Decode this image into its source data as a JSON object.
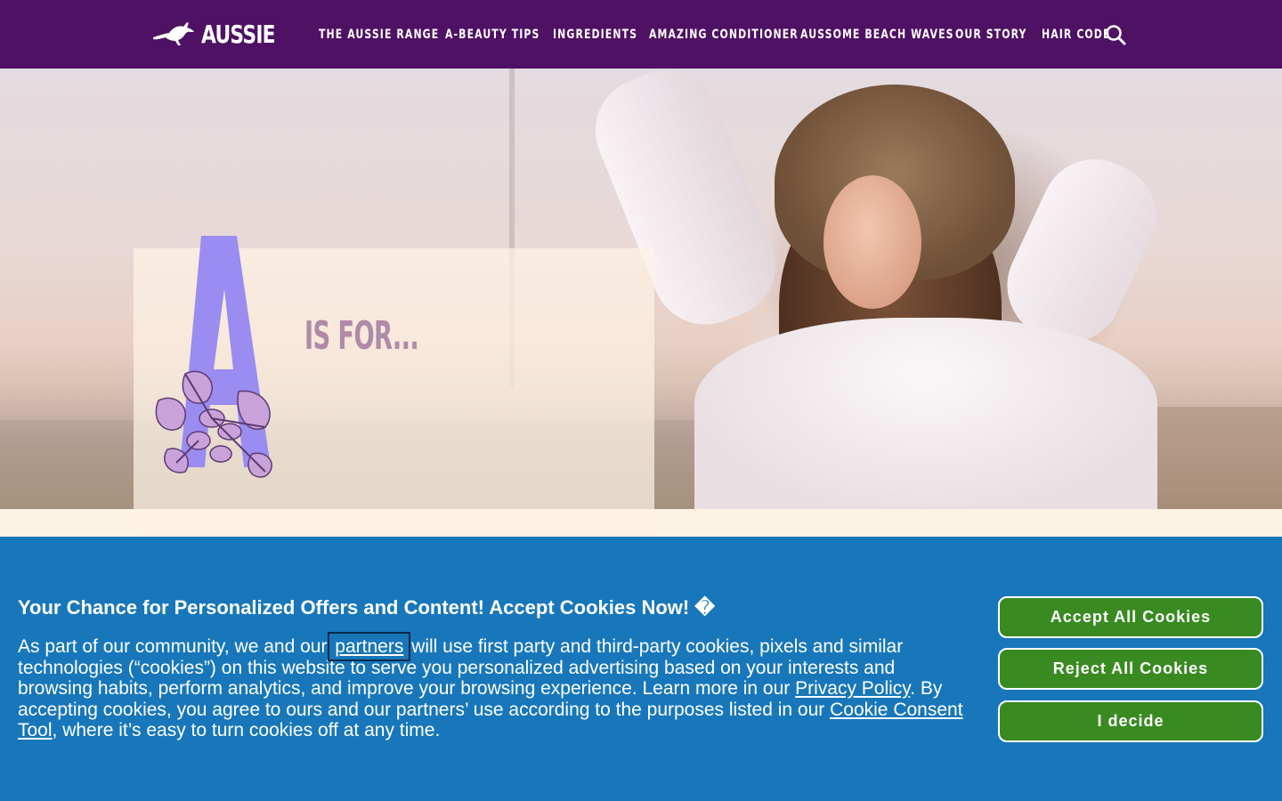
{
  "header": {
    "brand": "AUSSIE",
    "nav": [
      {
        "label": "THE AUSSIE RANGE"
      },
      {
        "label": "A-BEAUTY TIPS"
      },
      {
        "label": "INGREDIENTS"
      },
      {
        "label": "AMAZING CONDITIONER"
      },
      {
        "label": "AUSSOME BEACH WAVES"
      },
      {
        "label": "OUR STORY"
      },
      {
        "label": "HAIR CODE"
      }
    ],
    "search_icon": "search-icon"
  },
  "hero": {
    "letter": "A",
    "tagline": "IS FOR..."
  },
  "cookie_banner": {
    "title": "Your Chance for Personalized Offers and Content! Accept Cookies Now! �",
    "body_part1": "As part of our community, we and our ",
    "partners_link": "partners",
    "body_part2": " will use first party and third-party cookies, pixels and similar technologies (“cookies”) on this website to serve you personalized advertising based on your interests and browsing habits, perform analytics, and improve your browsing experience. Learn more in our ",
    "privacy_link": "Privacy Policy",
    "body_part3": ". By accepting cookies, you agree to ours and our partners’ use according to the purposes listed in our ",
    "consent_link": "Cookie Consent Tool",
    "body_part4": ", where it’s easy to turn cookies off at any time.",
    "accept_label": "Accept All Cookies",
    "reject_label": "Reject All Cookies",
    "decide_label": "I decide"
  },
  "colors": {
    "header_bg": "#4f1163",
    "banner_bg": "#1877ba",
    "button_bg": "#3a8a22",
    "letter": "#9a8cf0",
    "tagline": "#b08aa8"
  }
}
